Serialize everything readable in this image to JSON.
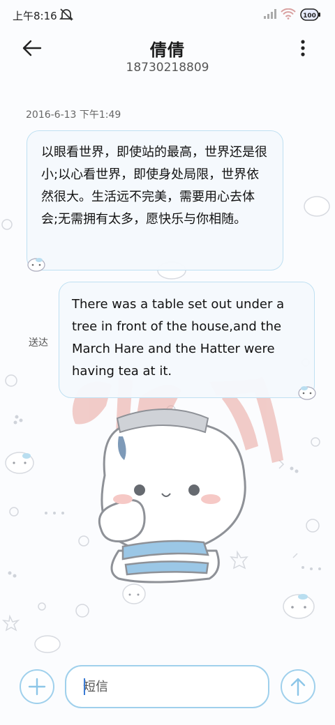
{
  "status_bar": {
    "time": "上午8:16",
    "icons": [
      "do-not-disturb-icon",
      "signal-icon",
      "wifi-icon",
      "battery-icon"
    ],
    "battery_label": "100"
  },
  "header": {
    "contact_name": "倩倩",
    "phone_number": "18730218809",
    "icons": [
      "back-arrow-icon",
      "more-vertical-icon"
    ]
  },
  "conversation": {
    "timestamp": "2016-6-13 下午1:49",
    "messages": [
      {
        "direction": "incoming",
        "text": "以眼看世界，即使站的最高，世界还是很小;以心看世界，即使身处局限，世界依然很大。生活远不完美，需要用心去体会;无需拥有太多，愿快乐与你相随。"
      },
      {
        "direction": "outgoing",
        "text": "There was a table set out under a tree in front of the house,and the March Hare and the Hatter were having tea at it.",
        "status": "送达"
      }
    ]
  },
  "composer": {
    "placeholder": "短信",
    "icons": [
      "add-icon",
      "send-arrow-icon"
    ]
  },
  "colors": {
    "accent": "#9fd0ec",
    "bubble_border": "#bfe0f2",
    "watermark": "#e9a49c"
  }
}
